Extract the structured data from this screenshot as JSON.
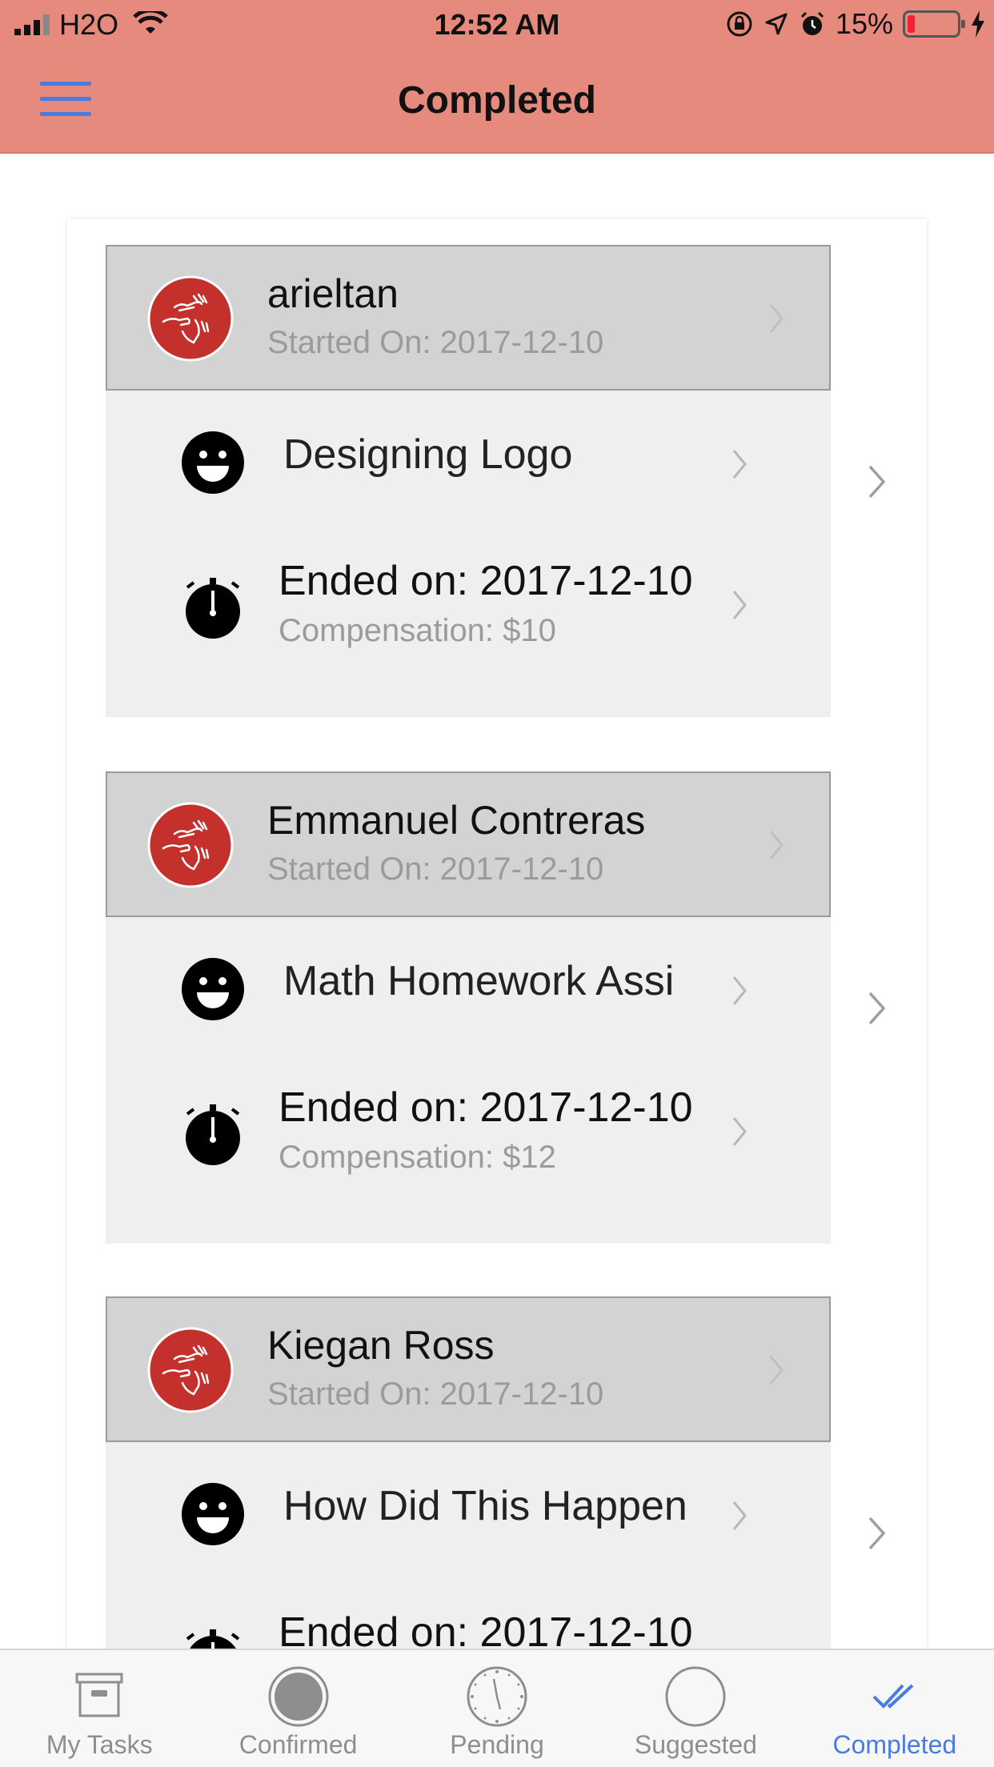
{
  "status_bar": {
    "carrier": "H2O",
    "time": "12:52 AM",
    "battery_percent": "15%",
    "battery_level": 0.15
  },
  "nav": {
    "title": "Completed",
    "menu_icon": "hamburger-menu-icon"
  },
  "cards": [
    {
      "user_name": "arieltan",
      "started_on": "Started On: 2017-12-10",
      "task_name": "Designing Logo",
      "ended_on": "Ended on: 2017-12-10",
      "compensation": "Compensation: $10"
    },
    {
      "user_name": "Emmanuel Contreras",
      "started_on": "Started On: 2017-12-10",
      "task_name": "Math Homework Assi",
      "ended_on": "Ended on: 2017-12-10",
      "compensation": "Compensation: $12"
    },
    {
      "user_name": "Kiegan Ross",
      "started_on": "Started On: 2017-12-10",
      "task_name": "How Did This Happen",
      "ended_on": "Ended on: 2017-12-10",
      "compensation": ""
    }
  ],
  "tabs": [
    {
      "label": "My Tasks",
      "icon": "archive-box-icon"
    },
    {
      "label": "Confirmed",
      "icon": "filled-circle-icon"
    },
    {
      "label": "Pending",
      "icon": "clock-icon"
    },
    {
      "label": "Suggested",
      "icon": "empty-circle-icon"
    },
    {
      "label": "Completed",
      "icon": "double-check-icon"
    }
  ],
  "active_tab": "Completed",
  "colors": {
    "header": "#e58a7c",
    "accent": "#4a7be0",
    "avatar": "#c4302b",
    "card_header": "#d3d3d3",
    "card_body": "#efefef"
  }
}
